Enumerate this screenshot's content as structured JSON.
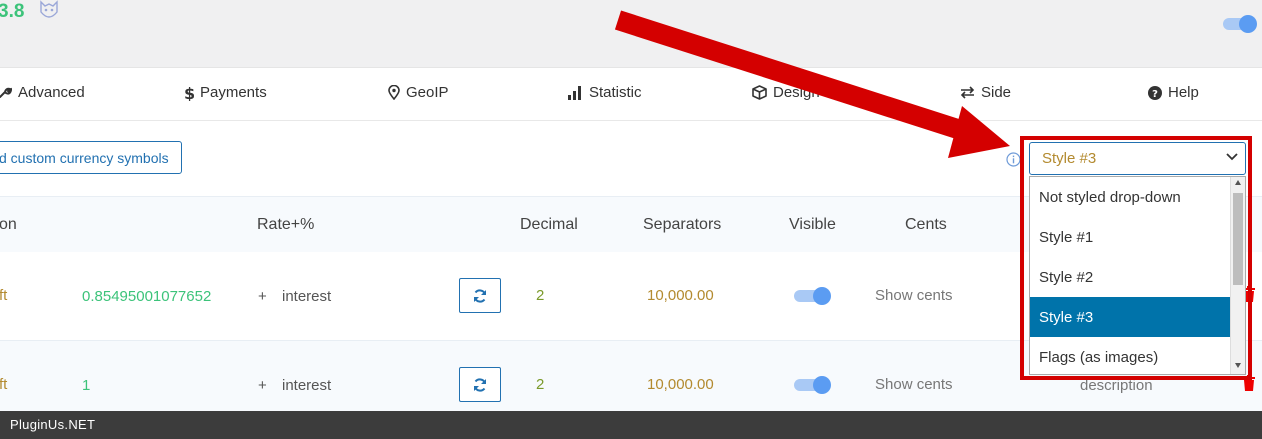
{
  "header": {
    "version": "3.8",
    "colors": {
      "accent": "#3cc37a",
      "primary": "#2271b1",
      "highlight": "#0073aa",
      "annotation": "#d40000"
    }
  },
  "tabs": [
    {
      "label": "Advanced",
      "icon": "wrench-icon"
    },
    {
      "label": "Payments",
      "icon": "dollar-icon"
    },
    {
      "label": "GeoIP",
      "icon": "map-pin-icon"
    },
    {
      "label": "Statistic",
      "icon": "bar-chart-icon"
    },
    {
      "label": "Design",
      "icon": "cube-icon"
    },
    {
      "label": "Side",
      "icon": "swap-icon"
    },
    {
      "label": "Help",
      "icon": "question-circle-icon"
    }
  ],
  "toolbar": {
    "symbols_button": "d custom currency symbols"
  },
  "table": {
    "headers": {
      "name": "on",
      "rate": "Rate+%",
      "decimal": "Decimal",
      "separators": "Separators",
      "visible": "Visible",
      "cents": "Cents"
    },
    "rows": [
      {
        "name": "ft",
        "rate": "0.85495001077652",
        "plus": "+",
        "interest": "interest",
        "decimal": "2",
        "separators": "10,000.00",
        "visible": true,
        "cents": "Show cents",
        "description": ""
      },
      {
        "name": "ft",
        "rate": "1",
        "plus": "+",
        "interest": "interest",
        "decimal": "2",
        "separators": "10,000.00",
        "visible": true,
        "cents": "Show cents",
        "description": "description"
      }
    ]
  },
  "style_select": {
    "selected": "Style #3",
    "options": [
      "Not styled drop-down",
      "Style #1",
      "Style #2",
      "Style #3",
      "Flags (as images)"
    ]
  },
  "footer": {
    "text": "PluginUs.NET"
  }
}
